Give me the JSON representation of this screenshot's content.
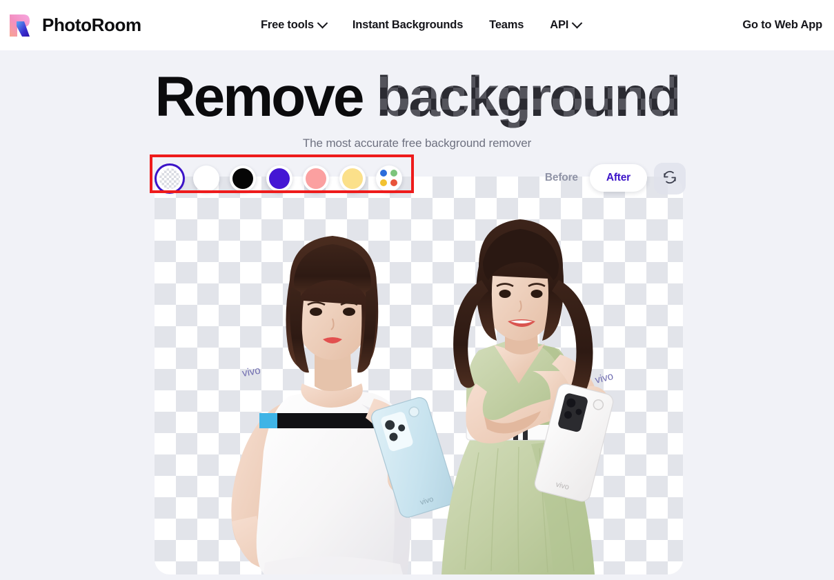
{
  "header": {
    "brand_name": "PhotoRoom",
    "logo_icon": "photoroom-r-logo-icon",
    "nav": [
      {
        "label": "Free tools",
        "has_dropdown": true,
        "icon": "chevron-down-icon"
      },
      {
        "label": "Instant Backgrounds",
        "has_dropdown": false
      },
      {
        "label": "Teams",
        "has_dropdown": false
      },
      {
        "label": "API",
        "has_dropdown": true,
        "icon": "chevron-down-icon"
      }
    ],
    "cta_label": "Go to Web App",
    "background_color": "#ffffff"
  },
  "hero": {
    "headline_plain": "Remove ",
    "headline_checkered": "background",
    "subheadline": "The most accurate free background remover",
    "page_background": "#f1f2f7",
    "headline_color": "#0b0b0d",
    "subheadline_color": "#6e7180"
  },
  "editor": {
    "background_swatches": [
      {
        "name": "transparent",
        "label": "Transparent",
        "color": "transparent",
        "selected": true,
        "ring_color": "#3c14c8"
      },
      {
        "name": "white",
        "label": "White",
        "color": "#ffffff",
        "selected": false
      },
      {
        "name": "black",
        "label": "Black",
        "color": "#060606",
        "selected": false
      },
      {
        "name": "purple",
        "label": "Purple",
        "color": "#4416d4",
        "selected": false
      },
      {
        "name": "pink",
        "label": "Pink",
        "color": "#fba0a0",
        "selected": false
      },
      {
        "name": "yellow",
        "label": "Yellow",
        "color": "#fbe08a",
        "selected": false
      },
      {
        "name": "more-colors",
        "label": "More colors",
        "color": "multi",
        "selected": false,
        "dots": [
          "#2b6cdb",
          "#7cc47c",
          "#f2c231",
          "#e8533a"
        ]
      }
    ],
    "toggle": {
      "before_label": "Before",
      "after_label": "After",
      "active": "After",
      "active_color": "#3c14c8",
      "inactive_color": "#8f93a6"
    },
    "refresh_button": {
      "icon": "refresh-swap-icon",
      "label": "Swap image"
    },
    "canvas": {
      "name": "transparency-checkerboard-canvas",
      "checker_light": "#ffffff",
      "checker_dark": "#e2e4ea",
      "subject_description": "Two women holding vivo smartphones with background removed"
    },
    "annotation": {
      "name": "swatch-row-highlight",
      "color": "#ee1b1b",
      "border_width": "4px"
    }
  }
}
